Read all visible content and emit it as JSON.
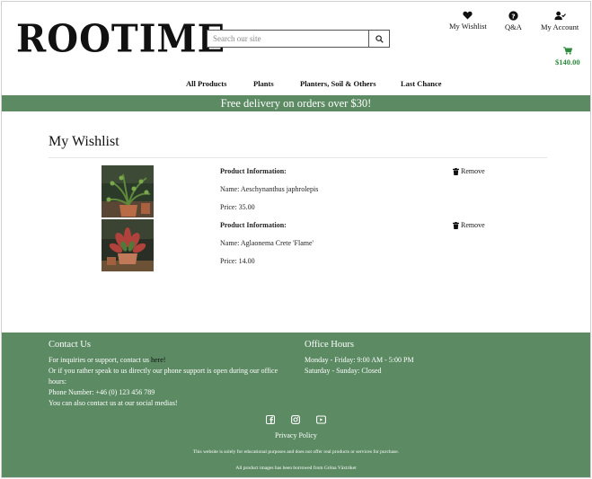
{
  "header": {
    "logo": "ROOTIME",
    "search_placeholder": "Search our site",
    "wishlist_label": "My Wishlist",
    "qa_label": "Q&A",
    "account_label": "My Account",
    "cart_total": "$140.00"
  },
  "nav": {
    "items": [
      "All Products",
      "Plants",
      "Planters, Soil & Others",
      "Last Chance"
    ]
  },
  "banner": {
    "text": "Free delivery on orders over $30!"
  },
  "main": {
    "title": "My Wishlist",
    "items": [
      {
        "info_label": "Product Information:",
        "name": "Name: Aeschynanthus japhrolepis",
        "price": "Price: 35.00",
        "remove_label": "Remove"
      },
      {
        "info_label": "Product Information:",
        "name": "Name: Aglaonema Crete 'Flame'",
        "price": "Price: 14.00",
        "remove_label": "Remove"
      }
    ]
  },
  "footer": {
    "contact_title": "Contact Us",
    "contact_line1": "For inquiries or support, contact us ",
    "contact_link": "here!",
    "contact_line2": "Or if you rather speak to us directly our phone support is open during our office hours:",
    "phone": "Phone Number: +46 (0) 123 456 789",
    "social_text": "You can also contact us at our social medias!",
    "hours_title": "Office Hours",
    "hours_weekday": "Monday - Friday: 9:00 AM - 5:00 PM",
    "hours_weekend": "Saturday - Sunday: Closed",
    "privacy": "Privacy Policy",
    "disclaimer": "This website is solely for educational purposes and does not offer real products or services for purchase.",
    "images_credit": "All product images has been borrowed from Gröna Växtriket"
  },
  "colors": {
    "brand_green": "#5b8a63",
    "price_green": "#2e8b3e"
  }
}
